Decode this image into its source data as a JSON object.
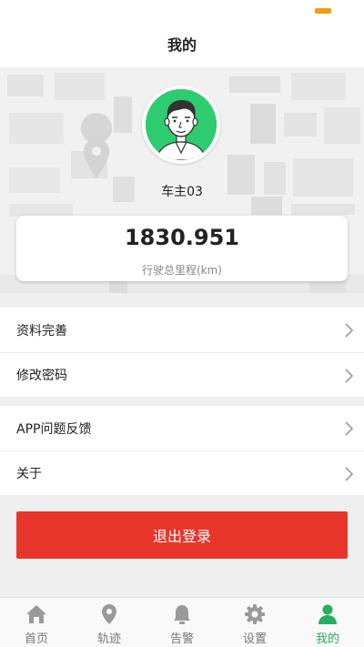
{
  "header": {
    "title": "我的"
  },
  "profile": {
    "username": "车主03"
  },
  "mileage": {
    "value": "1830.951",
    "label": "行驶总里程(km)"
  },
  "menu": {
    "section1": [
      {
        "label": "资料完善"
      },
      {
        "label": "修改密码"
      }
    ],
    "section2": [
      {
        "label": "APP问题反馈"
      },
      {
        "label": "关于"
      }
    ]
  },
  "logout": {
    "label": "退出登录"
  },
  "tabs": [
    {
      "label": "首页",
      "icon": "home-icon"
    },
    {
      "label": "轨迹",
      "icon": "location-pin-icon"
    },
    {
      "label": "告警",
      "icon": "bell-icon"
    },
    {
      "label": "设置",
      "icon": "gear-icon"
    },
    {
      "label": "我的",
      "icon": "user-icon",
      "active": true
    }
  ],
  "colors": {
    "accent": "#27ae60",
    "danger": "#e8352a",
    "avatar_bg": "#2ecc71",
    "inactive": "#9a9a9a"
  }
}
